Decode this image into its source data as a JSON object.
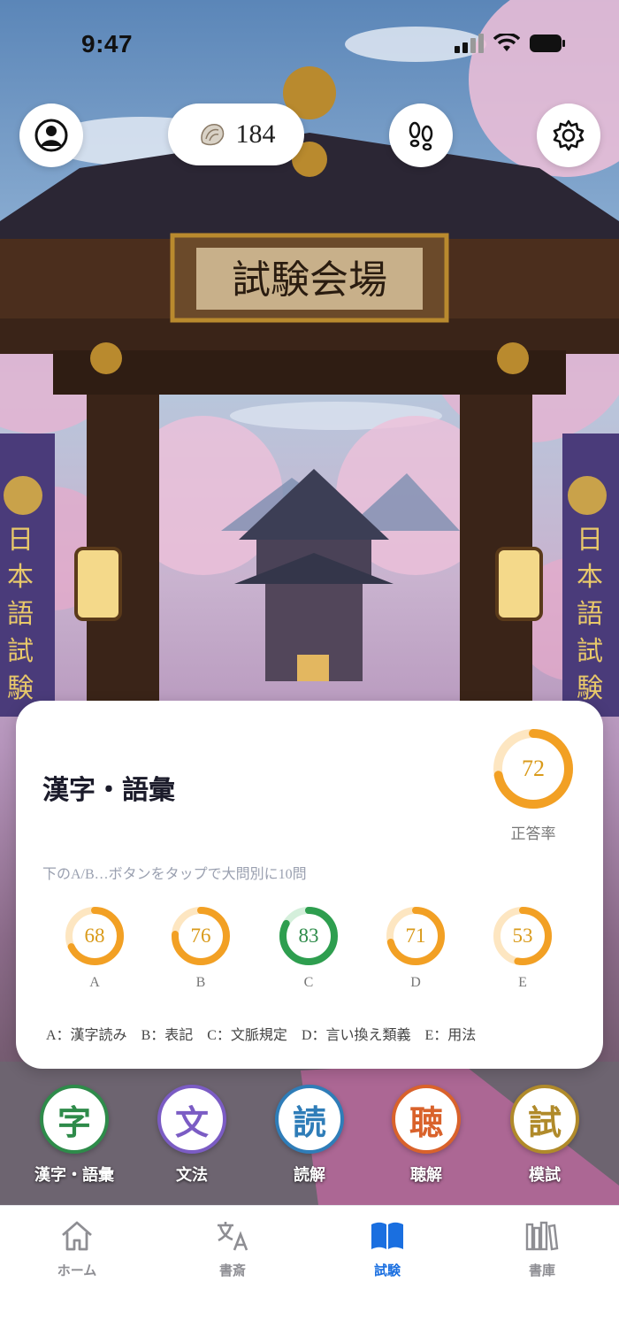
{
  "status": {
    "time": "9:47"
  },
  "header": {
    "shell_count": "184"
  },
  "scene": {
    "gate_sign": "試験会場",
    "banner_left": "日本語試験",
    "banner_right": "日本語試験"
  },
  "card": {
    "title": "漢字・語彙",
    "accuracy": {
      "value": "72",
      "percent": 72,
      "label": "正答率"
    },
    "hint": "下のA/B…ボタンをタップで大問別に10問",
    "sections": [
      {
        "letter": "A",
        "value": "68",
        "percent": 68,
        "color": "#f2a024"
      },
      {
        "letter": "B",
        "value": "76",
        "percent": 76,
        "color": "#f2a024"
      },
      {
        "letter": "C",
        "value": "83",
        "percent": 83,
        "color": "#2e9e4f"
      },
      {
        "letter": "D",
        "value": "71",
        "percent": 71,
        "color": "#f2a024"
      },
      {
        "letter": "E",
        "value": "53",
        "percent": 53,
        "color": "#f2a024"
      }
    ],
    "legend": [
      "A：漢字読み",
      "B：表記",
      "C：文脈規定",
      "D：言い換え類義",
      "E：用法"
    ]
  },
  "categories": [
    {
      "glyph": "字",
      "label": "漢字・語彙",
      "color": "#2e8b4a"
    },
    {
      "glyph": "文",
      "label": "文法",
      "color": "#7b5cc4"
    },
    {
      "glyph": "読",
      "label": "読解",
      "color": "#2f7db8"
    },
    {
      "glyph": "聴",
      "label": "聴解",
      "color": "#d9622b"
    },
    {
      "glyph": "試",
      "label": "模試",
      "color": "#b08a2a"
    }
  ],
  "tabs": [
    {
      "label": "ホーム",
      "icon": "home-icon"
    },
    {
      "label": "書斎",
      "icon": "translate-icon"
    },
    {
      "label": "試験",
      "icon": "book-icon",
      "active": true
    },
    {
      "label": "書庫",
      "icon": "library-icon"
    }
  ]
}
